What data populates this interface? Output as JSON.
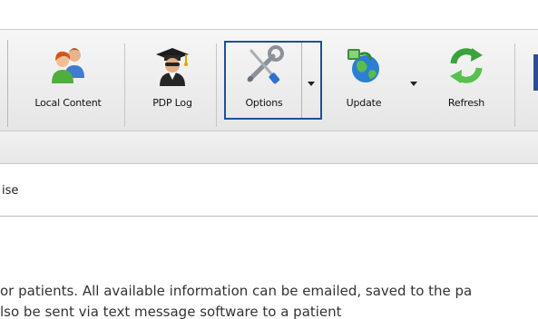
{
  "toolbar": {
    "buttons": [
      {
        "label": "Local Content",
        "icon": "users-icon"
      },
      {
        "label": "PDP Log",
        "icon": "graduate-icon"
      },
      {
        "label": "Options",
        "icon": "tools-icon",
        "selected": true
      },
      {
        "label": "Update",
        "icon": "globe-update-icon"
      },
      {
        "label": "Refresh",
        "icon": "refresh-icon"
      }
    ]
  },
  "panel": {
    "partial_label": "ise"
  },
  "content": {
    "line1": "or patients. All available information can be emailed, saved to the pa",
    "line2": "lso be sent via text message software to a patient"
  },
  "colors": {
    "selection_border": "#1f4f9a",
    "toolbar_bg": "#eeeeee",
    "refresh_green": "#3aa33a"
  }
}
